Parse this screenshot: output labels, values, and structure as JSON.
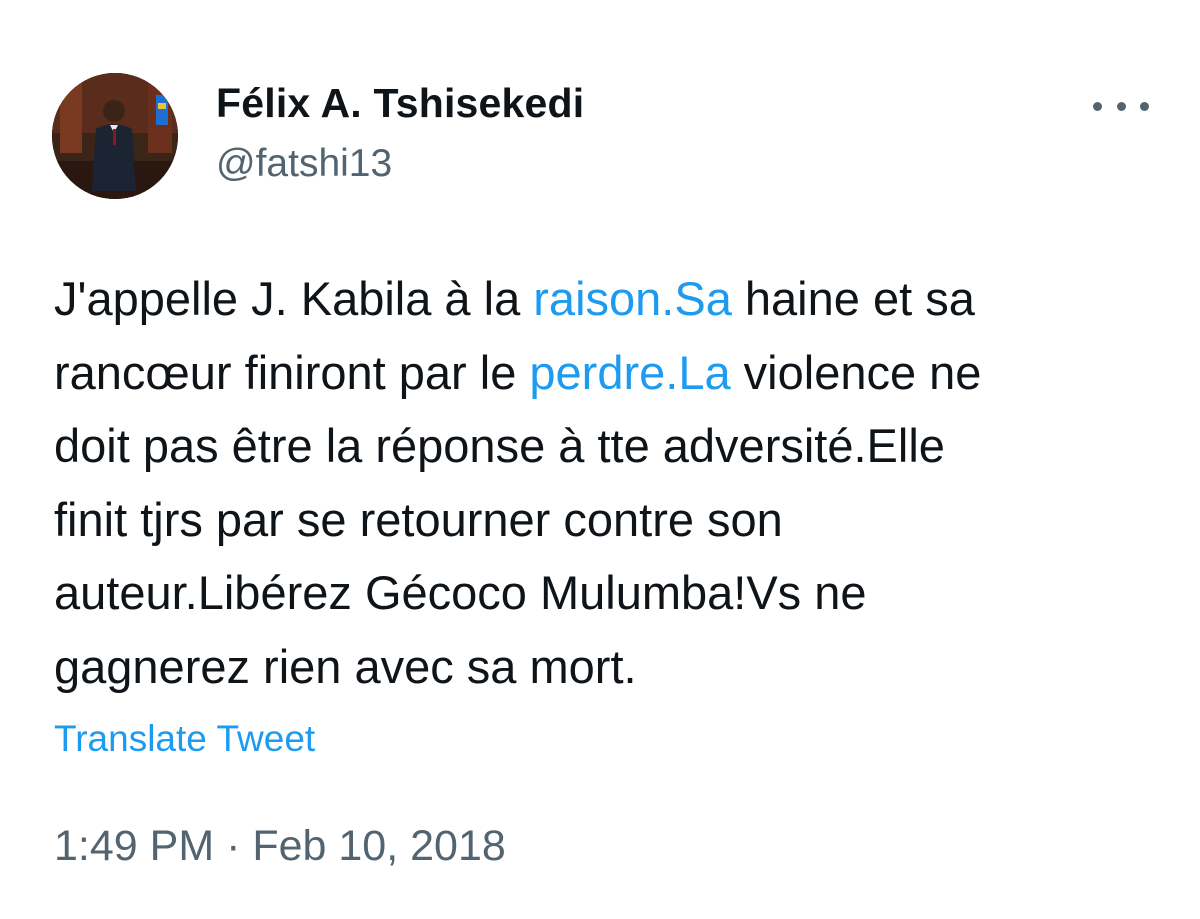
{
  "author": {
    "display_name": "Félix A. Tshisekedi",
    "handle": "@fatshi13",
    "avatar_icon": "profile-photo"
  },
  "menu_icon": "more-options-icon",
  "tweet": {
    "lines": [
      [
        {
          "text": "J'appelle J. Kabila à la ",
          "link": false
        },
        {
          "text": "raison.Sa",
          "link": true
        },
        {
          "text": " haine et sa",
          "link": false
        }
      ],
      [
        {
          "text": "rancœur finiront par le ",
          "link": false
        },
        {
          "text": "perdre.La",
          "link": true
        },
        {
          "text": " violence ne",
          "link": false
        }
      ],
      [
        {
          "text": "doit pas être la réponse à tte adversité.Elle",
          "link": false
        }
      ],
      [
        {
          "text": "finit tjrs par se retourner contre son",
          "link": false
        }
      ],
      [
        {
          "text": "auteur.Libérez Gécoco Mulumba!Vs ne",
          "link": false
        }
      ],
      [
        {
          "text": "gagnerez rien avec sa mort.",
          "link": false
        }
      ]
    ],
    "translate_label": "Translate Tweet",
    "timestamp": "1:49 PM · Feb 10, 2018"
  },
  "colors": {
    "text": "#0f1419",
    "secondary": "#536471",
    "link": "#1d9bf0"
  }
}
